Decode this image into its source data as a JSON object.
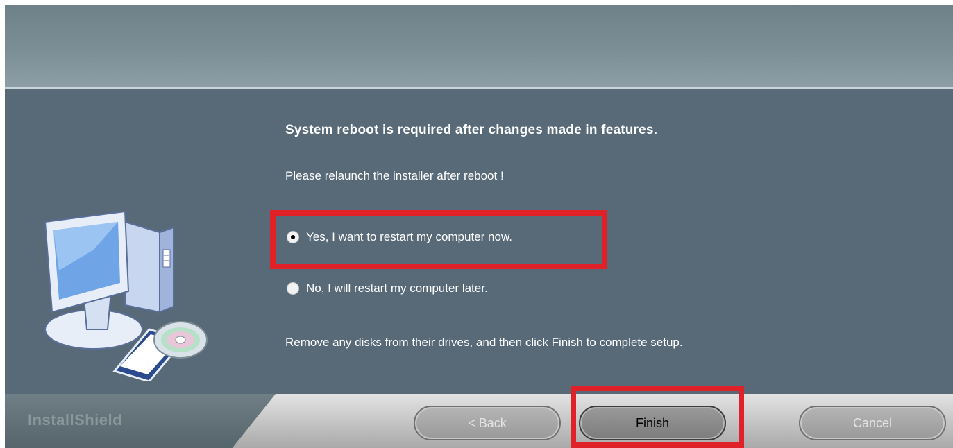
{
  "dialog": {
    "heading": "System reboot is required after changes made in features.",
    "subtext": "Please relaunch the installer after reboot !",
    "options": [
      {
        "label": "Yes, I want to restart my computer now.",
        "selected": true
      },
      {
        "label": "No, I will restart my computer later.",
        "selected": false
      }
    ],
    "note": "Remove any disks from their drives, and then click Finish to complete setup."
  },
  "footer": {
    "brand": "InstallShield",
    "back_label": "< Back",
    "finish_label": "Finish",
    "cancel_label": "Cancel"
  },
  "illustration": "computer-with-cd-icon",
  "colors": {
    "panel": "#586a78",
    "header": "#7c8e96",
    "highlight": "#e02128"
  }
}
